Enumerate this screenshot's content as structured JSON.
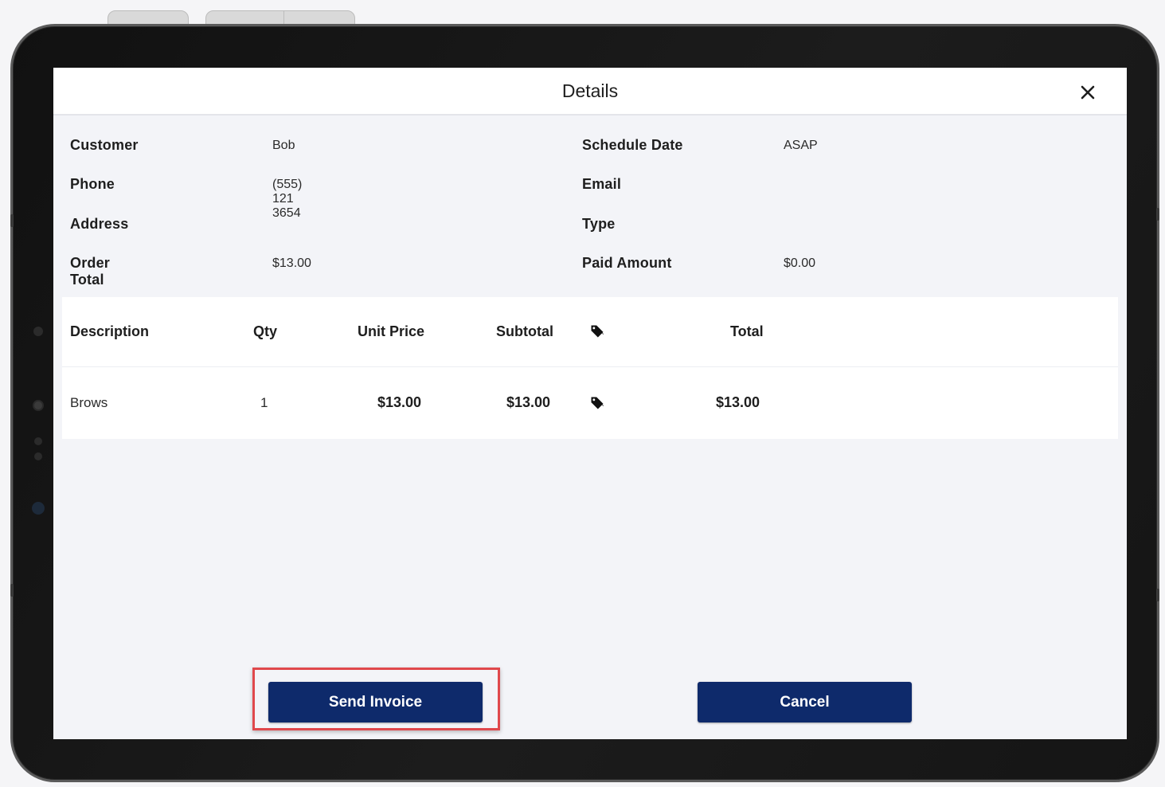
{
  "dialog": {
    "title": "Details",
    "close_icon": "close-icon"
  },
  "info": {
    "customer_label": "Customer",
    "customer_value": "Bob",
    "phone_label": "Phone",
    "phone_value": "(555) 121 3654",
    "address_label": "Address",
    "address_value": "",
    "order_total_label": "Order Total",
    "order_total_value": "$13.00",
    "schedule_date_label": "Schedule Date",
    "schedule_date_value": "ASAP",
    "email_label": "Email",
    "email_value": "",
    "type_label": "Type",
    "type_value": "",
    "paid_amount_label": "Paid Amount",
    "paid_amount_value": "$0.00"
  },
  "table": {
    "headers": {
      "description": "Description",
      "qty": "Qty",
      "unit_price": "Unit Price",
      "subtotal": "Subtotal",
      "discount_icon": "tag-icon",
      "total": "Total"
    },
    "rows": [
      {
        "description": "Brows",
        "qty": "1",
        "unit_price": "$13.00",
        "subtotal": "$13.00",
        "discount_icon": "tag-icon",
        "total": "$13.00"
      }
    ]
  },
  "actions": {
    "send_invoice_label": "Send Invoice",
    "cancel_label": "Cancel"
  },
  "colors": {
    "primary_button": "#0e2a6b",
    "highlight_border": "#e0484c",
    "background": "#f3f4f8"
  }
}
